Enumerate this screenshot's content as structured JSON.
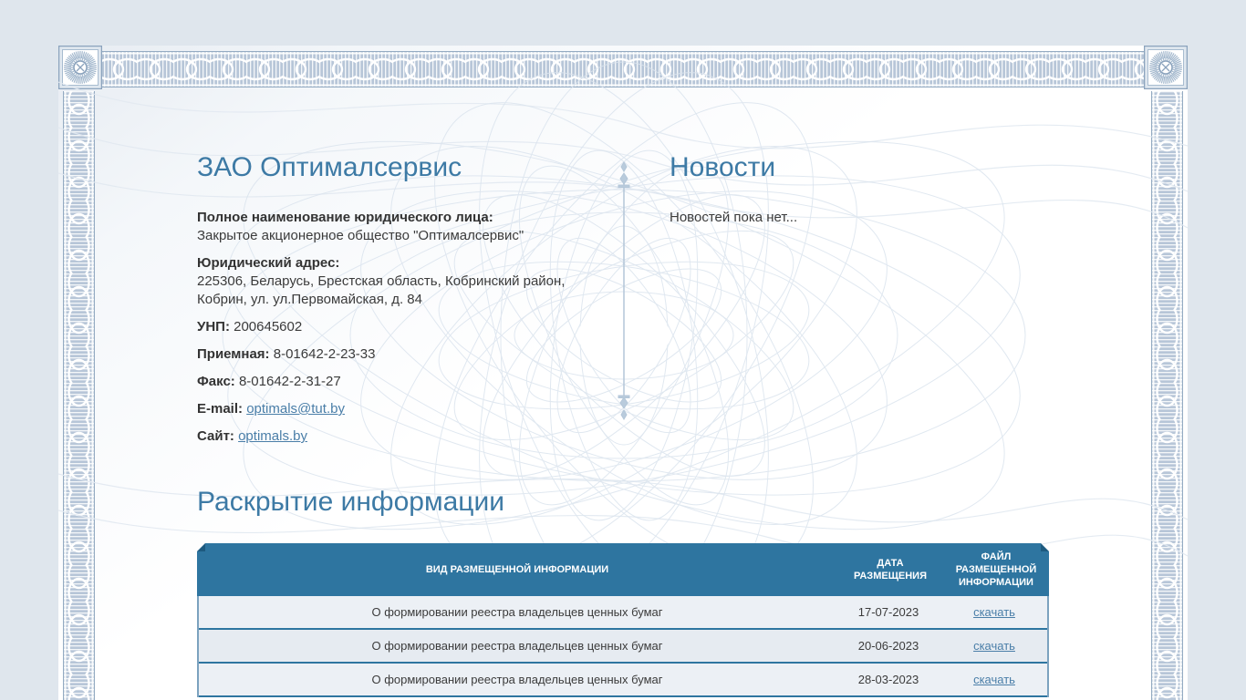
{
  "company": {
    "title": "ЗАО Оптималсервис",
    "full_name": {
      "label": "Полное наименование юридического лица:",
      "value": "Закрытое акционерное общество \"Оптималсервис\""
    },
    "address": {
      "label": "Юридический адрес:",
      "line1": "225306, Беларусь, Брестская область, Кобринский район,",
      "line2": "Кобрин, ул. ул.Первомайская, д. 84"
    },
    "unp": {
      "label": "УНП:",
      "value": "200645602"
    },
    "reception": {
      "label": "Приемная:",
      "value": "8-01642-2-23-33"
    },
    "fax": {
      "label": "Факс:",
      "value": "8-01642-2-31-27"
    },
    "email": {
      "label": "E-mail:",
      "value": "optimals@tut.by"
    },
    "site": {
      "label": "Сайт:",
      "value": "optimals.by"
    }
  },
  "news": {
    "title": "Новости",
    "empty_text": "Новостей пока нет..."
  },
  "disclosure": {
    "title": "Раскрытие информации",
    "table": {
      "headers": [
        "ВИД РАЗМЕЩЕННОЙ ИНФОРМАЦИИ",
        "ДАТА РАЗМЕЩЕНИЯ",
        "ФАЙЛ РАЗМЕЩЕННОЙ ИНФОРМАЦИИ"
      ],
      "rows": [
        {
          "type": "О формировании реестра владельцев ценных бумаг",
          "date": "17-07-2023",
          "file_link": "скачать"
        },
        {
          "type": "О формировании реестра владельцев ценных бумаг",
          "date": "20-06-2023",
          "file_link": "скачать"
        },
        {
          "type": "О формировании реестра владельцев ценных бумаг",
          "date": "28-03-2023",
          "file_link": "скачать"
        }
      ]
    }
  },
  "colors": {
    "accent": "#2e75a0",
    "heading": "#3d7aa5",
    "link": "#4a7ea8",
    "page_bg": "#dfe6ed",
    "border_pattern": "#b7c6d8",
    "row_bg": "#eaeff4"
  }
}
